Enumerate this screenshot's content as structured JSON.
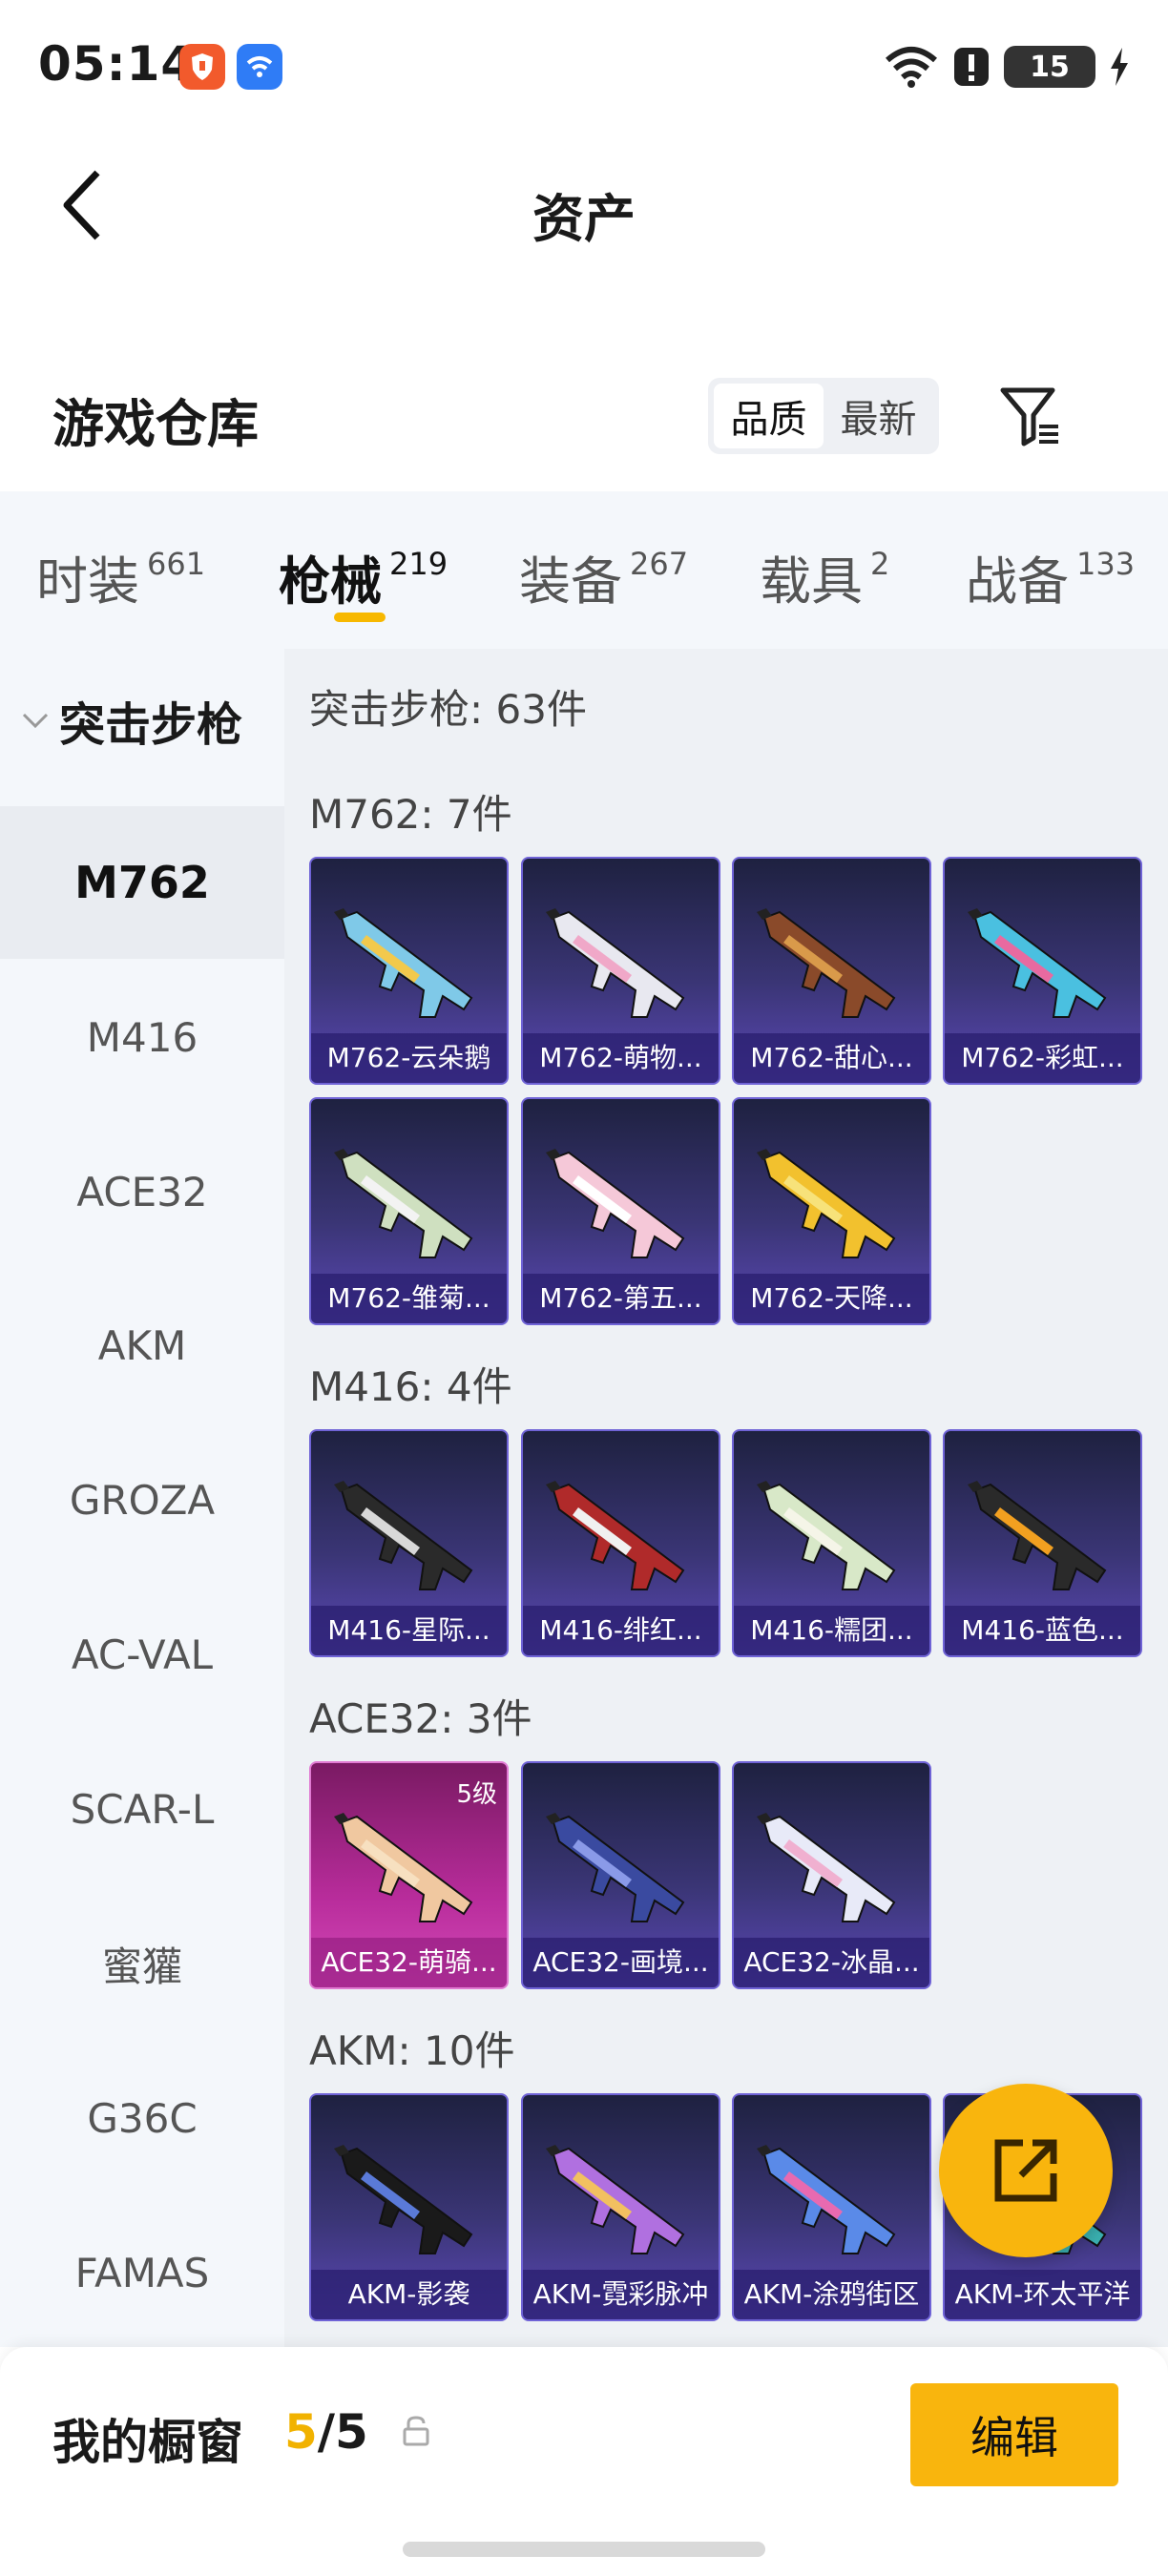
{
  "status": {
    "time": "05:14",
    "battery": "15"
  },
  "nav": {
    "title": "资产"
  },
  "section": {
    "title": "游戏仓库",
    "sort_quality": "品质",
    "sort_newest": "最新"
  },
  "tabs": [
    {
      "label": "时装",
      "count": "661"
    },
    {
      "label": "枪械",
      "count": "219"
    },
    {
      "label": "装备",
      "count": "267"
    },
    {
      "label": "载具",
      "count": "2"
    },
    {
      "label": "战备",
      "count": "133"
    }
  ],
  "sidebar": {
    "group": "突击步枪",
    "items": [
      "M762",
      "M416",
      "ACE32",
      "AKM",
      "GROZA",
      "AC-VAL",
      "SCAR-L",
      "蜜獾",
      "G36C",
      "FAMAS"
    ]
  },
  "content": {
    "header": "突击步枪: 63件",
    "groups": [
      {
        "title": "M762: 7件",
        "items": [
          "M762-云朵鹅",
          "M762-萌物...",
          "M762-甜心...",
          "M762-彩虹...",
          "M762-雏菊...",
          "M762-第五...",
          "M762-天降..."
        ]
      },
      {
        "title": "M416: 4件",
        "items": [
          "M416-星际...",
          "M416-绯红...",
          "M416-糯团...",
          "M416-蓝色..."
        ]
      },
      {
        "title": "ACE32: 3件",
        "items": [
          "ACE32-萌骑...",
          "ACE32-画境...",
          "ACE32-冰晶..."
        ],
        "badge": "5级"
      },
      {
        "title": "AKM: 10件",
        "items": [
          "AKM-影袭",
          "AKM-霓彩脉冲",
          "AKM-涂鸦街区",
          "AKM-环太平洋"
        ]
      }
    ]
  },
  "bottom": {
    "title": "我的橱窗",
    "count_current": "5",
    "count_total": "/5",
    "edit": "编辑"
  },
  "colors": {
    "accent": "#f9b50d",
    "card_blue": "#5b48b6",
    "card_pink": "#d54ab9"
  }
}
